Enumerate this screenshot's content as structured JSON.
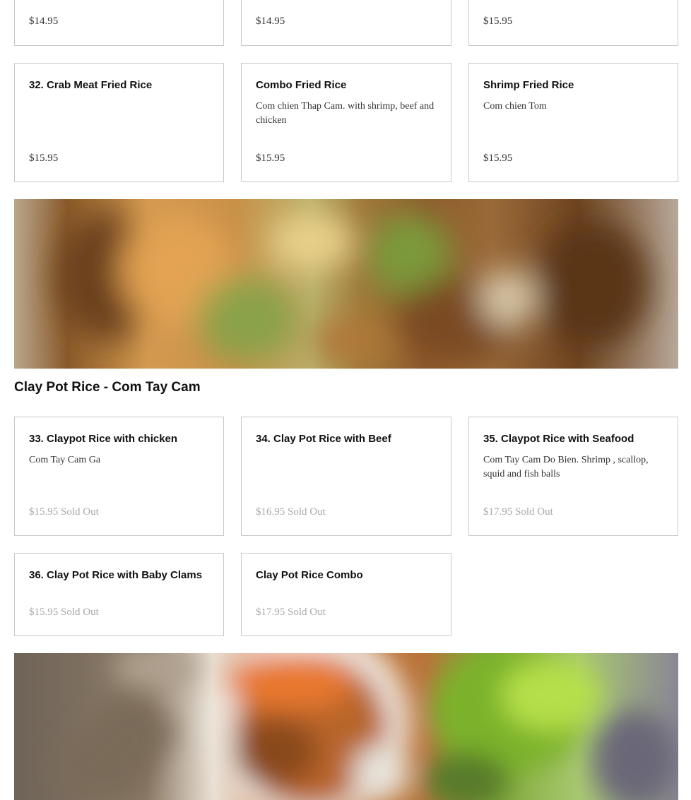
{
  "top_row": [
    {
      "price": "$14.95"
    },
    {
      "price": "$14.95"
    },
    {
      "price": "$15.95"
    }
  ],
  "fried_rice": [
    {
      "name": "32. Crab Meat Fried Rice",
      "desc": "",
      "price": "$15.95"
    },
    {
      "name": "Combo Fried Rice",
      "desc": "Com chien Thap Cam. with shrimp, beef and chicken",
      "price": "$15.95"
    },
    {
      "name": "Shrimp Fried Rice",
      "desc": "Com chien Tom",
      "price": "$15.95"
    }
  ],
  "clay_pot": {
    "title": "Clay Pot Rice - Com Tay Cam",
    "items": [
      {
        "name": "33. Claypot Rice with chicken",
        "desc": "Com Tay Cam Ga",
        "price": "$15.95",
        "status": "Sold Out"
      },
      {
        "name": "34. Clay Pot Rice with Beef",
        "desc": "",
        "price": "$16.95",
        "status": "Sold Out"
      },
      {
        "name": "35. Claypot Rice with Seafood",
        "desc": "Com Tay Cam Do Bien. Shrimp , scallop, squid and fish balls",
        "price": "$17.95",
        "status": "Sold Out"
      },
      {
        "name": "36. Clay Pot Rice with Baby Clams",
        "desc": "",
        "price": "$15.95",
        "status": "Sold Out"
      },
      {
        "name": "Clay Pot Rice Combo",
        "desc": "",
        "price": "$17.95",
        "status": "Sold Out"
      }
    ]
  },
  "colors": {
    "border": "#c9c9c9",
    "sold_out_text": "#a8a8a8",
    "text": "#111111"
  }
}
